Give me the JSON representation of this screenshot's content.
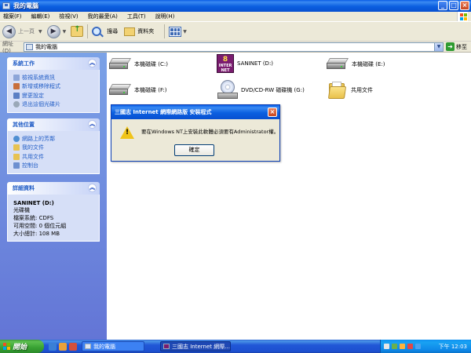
{
  "window": {
    "title": "我的電腦"
  },
  "menu": [
    "檔案(F)",
    "編輯(E)",
    "檢視(V)",
    "我的最愛(A)",
    "工具(T)",
    "說明(H)"
  ],
  "toolbar": {
    "back_label": "上一頁",
    "search_label": "搜尋",
    "folders_label": "資料夾"
  },
  "address": {
    "label": "網址(D)",
    "value": "我的電腦",
    "go_label": "移至"
  },
  "panels": {
    "system_tasks": {
      "title": "系統工作",
      "items": [
        "檢視系統資訊",
        "新增或移除程式",
        "變更設定",
        "退出這個光碟片"
      ]
    },
    "other_places": {
      "title": "其他位置",
      "items": [
        "網路上的芳鄰",
        "我的文件",
        "共用文件",
        "控制台"
      ]
    },
    "details": {
      "title": "詳細資料",
      "name": "SANINET (D:)",
      "lines": [
        "光碟機",
        "檔案系統: CDFS",
        "可用空間: 0 個位元組",
        "大小總計: 108 MB"
      ]
    }
  },
  "drives": [
    {
      "label": "本機磁碟 (C:)",
      "icon": "hard-drive-icon"
    },
    {
      "label": "SANINET (D:)",
      "icon": "cd-autorun-icon"
    },
    {
      "label": "本機磁碟 (E:)",
      "icon": "hard-drive-icon"
    },
    {
      "label": "本機磁碟 (F:)",
      "icon": "hard-drive-icon"
    },
    {
      "label": "DVD/CD-RW 磁碟機 (G:)",
      "icon": "dvd-drive-icon"
    },
    {
      "label": "共用文件",
      "icon": "shared-folder-icon"
    }
  ],
  "dialog": {
    "title": "三國志 Internet 網際網路版 安裝程式",
    "message": "要在Windows NT上安裝此軟體必須要有Administrator權。",
    "ok_label": "確定"
  },
  "taskbar": {
    "start_label": "開始",
    "tasks": [
      "我的電腦",
      "三國志 Internet 網際..."
    ],
    "clock": "下午 12:03"
  },
  "colors": {
    "xp_blue": "#0a5ee6",
    "task_pane_top": "#7ba2e7",
    "task_pane_bottom": "#6375d6",
    "start_green": "#3c9a3a"
  }
}
